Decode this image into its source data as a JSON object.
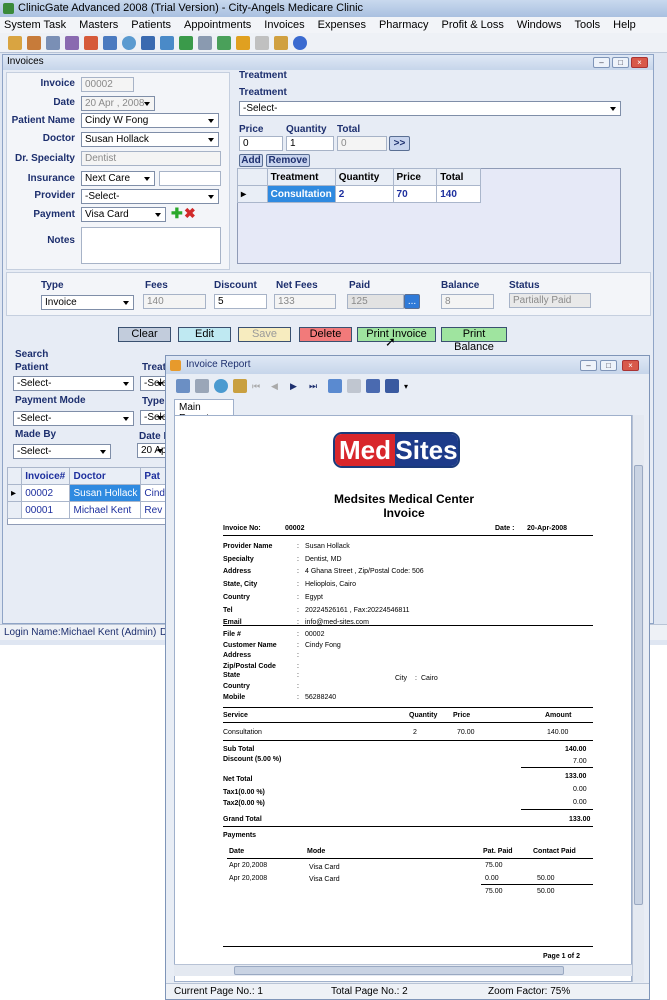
{
  "app": {
    "title": "ClinicGate Advanced 2008 (Trial Version) - City-Angels Medicare Clinic",
    "menu": [
      "System Task",
      "Masters",
      "Patients",
      "Appointments",
      "Invoices",
      "Expenses",
      "Pharmacy",
      "Profit & Loss",
      "Windows",
      "Tools",
      "Help"
    ],
    "status": "Login Name:Michael Kent (Admin)",
    "status_extra": "D"
  },
  "invoice_window": {
    "title": "Invoices",
    "labels": {
      "invoice": "Invoice",
      "date": "Date",
      "patient_name": "Patient Name",
      "doctor": "Doctor",
      "dr_specialty": "Dr. Specialty",
      "insurance": "Insurance",
      "provider": "Provider",
      "payment": "Payment",
      "notes": "Notes"
    },
    "values": {
      "invoice": "00002",
      "date": "20 Apr , 2008",
      "patient_name": "Cindy W Fong",
      "doctor": "Susan Hollack",
      "dr_specialty": "Dentist",
      "insurance": "Next Care",
      "insurance_extra": "",
      "provider": "-Select-",
      "payment": "Visa Card"
    },
    "treatment": {
      "group_label": "Treatment",
      "label": "Treatment",
      "select": "-Select-",
      "price_label": "Price",
      "quantity_label": "Quantity",
      "total_label": "Total",
      "price": "0",
      "quantity": "1",
      "total": "0",
      "go": ">>",
      "add": "Add",
      "remove": "Remove",
      "columns": [
        "Treatment",
        "Quantity",
        "Price",
        "Total"
      ],
      "rows": [
        [
          "Consultation",
          "2",
          "70",
          "140"
        ]
      ]
    },
    "summary": {
      "labels": {
        "type": "Type",
        "fees": "Fees",
        "discount": "Discount",
        "net_fees": "Net Fees",
        "paid": "Paid",
        "balance": "Balance",
        "status": "Status"
      },
      "values": {
        "type": "Invoice",
        "fees": "140",
        "discount": "5",
        "net_fees": "133",
        "paid": "125",
        "paid_btn": "...",
        "balance": "8",
        "status": "Partially Paid"
      }
    },
    "actions": {
      "clear": "Clear",
      "edit": "Edit",
      "save": "Save",
      "delete": "Delete",
      "print_invoice": "Print Invoice",
      "print_balance": "Print Balance"
    },
    "search": {
      "title": "Search",
      "patient": "Patient",
      "patient_value": "-Select-",
      "treatment": "Treatm",
      "treatment_value": "-Selec",
      "payment_mode": "Payment Mode",
      "payment_mode_value": "-Select-",
      "type": "Type",
      "type_value": "-Selec",
      "made_by": "Made By",
      "made_by_value": "-Select-",
      "date_from": "Date F",
      "date_from_value": "20 Apr"
    },
    "list": {
      "columns": [
        "Invoice#",
        "Doctor",
        "Pat"
      ],
      "rows": [
        [
          "00002",
          "Susan Hollack",
          "Cind"
        ],
        [
          "00001",
          "Michael Kent",
          "Rev"
        ]
      ]
    }
  },
  "report_window": {
    "title": "Invoice Report",
    "tab": "Main Report",
    "status": {
      "current": "Current Page No.: 1",
      "total": "Total Page No.: 2",
      "zoom": "Zoom Factor: 75%"
    },
    "logo": {
      "left": "Med",
      "right": "Sites"
    },
    "center": "Medsites Medical Center",
    "doc_title": "Invoice",
    "invoice_no_label": "Invoice No:",
    "invoice_no": "00002",
    "date_label": "Date :",
    "date": "20-Apr-2008",
    "provider_labels": [
      "Provider Name",
      "Specialty",
      "Address",
      "State, City",
      "Country",
      "Tel",
      "Email"
    ],
    "provider_values": [
      "Susan Hollack",
      "Dentist, MD",
      "4 Ghana Street , Zip/Postal Code: 506",
      "Helioplois, Cairo",
      "Egypt",
      "20224526161 , Fax:20224546811",
      "info@med-sites.com"
    ],
    "customer_labels": [
      "File #",
      "Customer Name",
      "Address",
      "Zip/Postal Code",
      "State",
      "Country",
      "Mobile"
    ],
    "customer_values": [
      "00002",
      "Cindy Fong",
      "",
      "",
      "",
      "",
      "56288240"
    ],
    "city_label": "City",
    "city": "Cairo",
    "service_cols": [
      "Service",
      "Quantity",
      "Price",
      "Amount"
    ],
    "service_rows": [
      [
        "Consultation",
        "2",
        "70.00",
        "140.00"
      ]
    ],
    "totals": {
      "sub_total_label": "Sub Total",
      "sub_total": "140.00",
      "discount_label": "Discount (5.00 %)",
      "discount": "7.00",
      "net_total_label": "Net Total",
      "net_total": "133.00",
      "tax1_label": "Tax1(0.00 %)",
      "tax1": "0.00",
      "tax2_label": "Tax2(0.00 %)",
      "tax2": "0.00",
      "grand_total_label": "Grand Total",
      "grand_total": "133.00"
    },
    "payments_label": "Payments",
    "payment_cols": [
      "Date",
      "Mode",
      "Pat. Paid",
      "Contact Paid"
    ],
    "payment_rows": [
      [
        "Apr 20,2008",
        "Visa Card",
        "75.00",
        ""
      ],
      [
        "Apr 20,2008",
        "Visa Card",
        "0.00",
        "50.00"
      ]
    ],
    "payment_totals": [
      "75.00",
      "50.00"
    ],
    "page": "Page 1 of 2"
  }
}
